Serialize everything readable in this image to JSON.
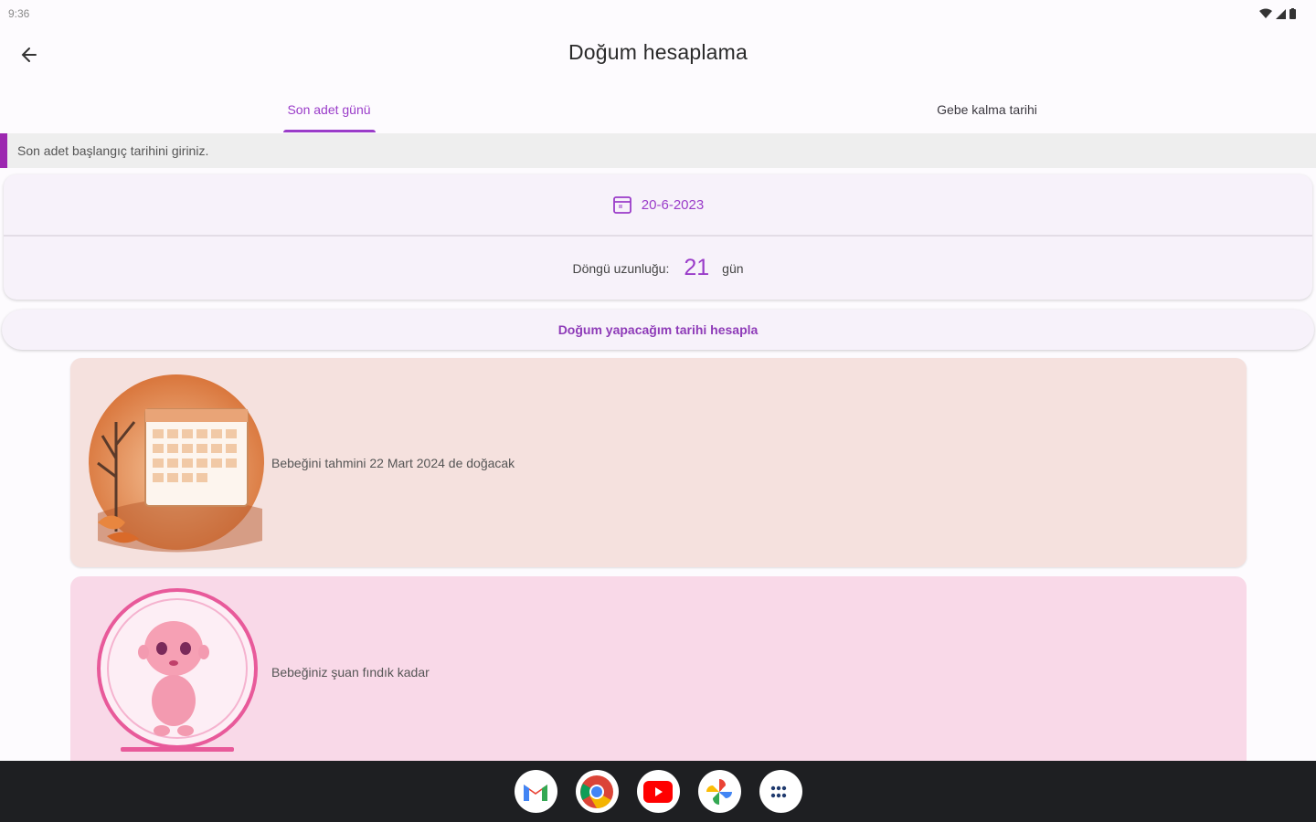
{
  "status_bar": {
    "time": "9:36"
  },
  "app_bar": {
    "title": "Doğum hesaplama",
    "back_icon": "arrow-left-icon"
  },
  "tabs": [
    {
      "label": "Son adet günü",
      "active": true
    },
    {
      "label": "Gebe kalma tarihi",
      "active": false
    }
  ],
  "hint": "Son adet başlangıç tarihini giriniz.",
  "date_picker": {
    "value": "20-6-2023",
    "icon": "calendar-icon"
  },
  "cycle": {
    "label": "Döngü uzunluğu:",
    "value": "21",
    "unit": "gün"
  },
  "calculate_button": "Doğum yapacağım tarihi hesapla",
  "cards": [
    {
      "text": "Bebeğini tahmini 22 Mart 2024 de doğacak",
      "image": "calendar-illustration"
    },
    {
      "text": "Bebeğiniz şuan fındık kadar",
      "image": "baby-illustration"
    }
  ],
  "dock": [
    "gmail-icon",
    "chrome-icon",
    "youtube-icon",
    "photos-icon",
    "apps-icon"
  ],
  "colors": {
    "accent": "#9a3cc9",
    "indicator": "#9c27b0",
    "card1_bg": "#f5e1de",
    "card2_bg": "#f9d9e8"
  }
}
